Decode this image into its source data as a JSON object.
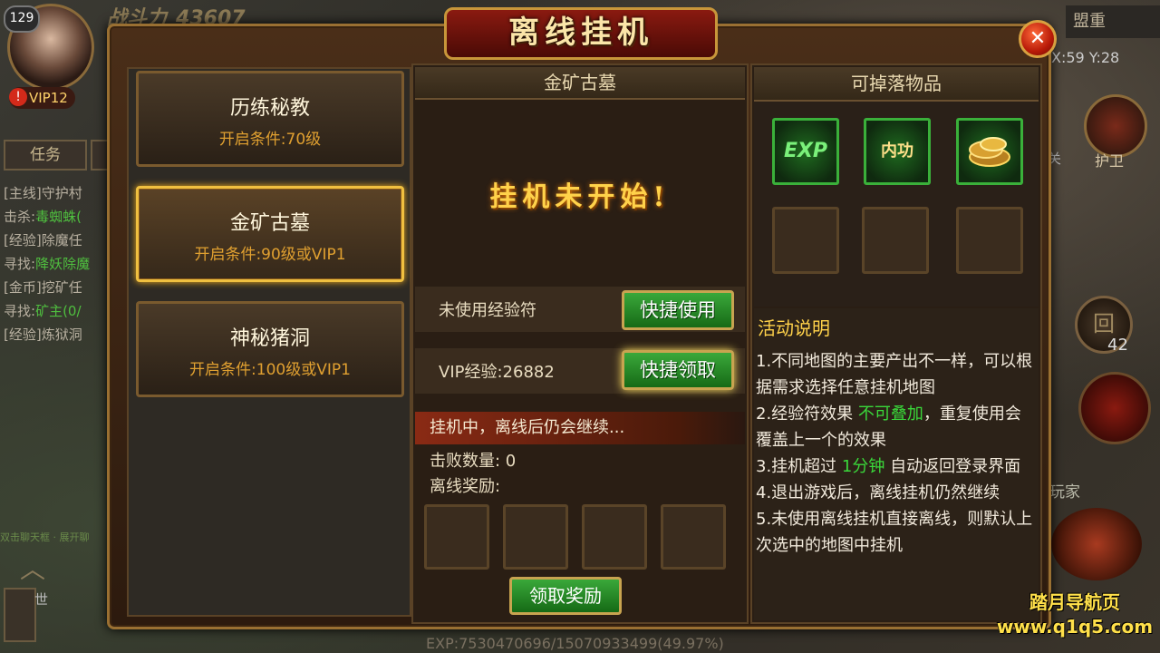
{
  "hud": {
    "level": "129",
    "vip": "VIP12",
    "power_label": "战斗力",
    "power_value": "43607",
    "task_tab": "任务",
    "quests": [
      {
        "tag": "[主线]",
        "text": "守护村"
      },
      {
        "tag": "击杀:",
        "text": "毒蜘蛛(",
        "hl": true
      },
      {
        "tag": "[经验]",
        "text": "除魔任"
      },
      {
        "tag": "寻找:",
        "text": "降妖除魔",
        "hl": true
      },
      {
        "tag": "[金币]",
        "text": "挖矿任"
      },
      {
        "tag": "寻找:",
        "text": "矿主(0/",
        "hl": true
      },
      {
        "tag": "[经验]",
        "text": "炼狱洞"
      }
    ],
    "chat_text": "双击聊天框 · 展开聊",
    "world_label": "世",
    "alliance": "盟重",
    "coords": "X:59 Y:28",
    "guard_label": "护卫",
    "guard_side_label": "关",
    "return_label": "回",
    "count_42": "42",
    "player_label": "玩家",
    "exp": "EXP:7530470696/15070933499(49.97%)"
  },
  "window": {
    "title": "离线挂机",
    "close_icon": "close-x-icon"
  },
  "maps": [
    {
      "name": "历练秘教",
      "cond": "开启条件:70级",
      "selected": false
    },
    {
      "name": "金矿古墓",
      "cond": "开启条件:90级或VIP1",
      "selected": true
    },
    {
      "name": "神秘猪洞",
      "cond": "开启条件:100级或VIP1",
      "selected": false
    }
  ],
  "middle": {
    "header": "金矿古墓",
    "not_started": "挂机未开始!",
    "exp_charm_label": "未使用经验符",
    "use_button": "快捷使用",
    "vip_exp_label": "VIP经验:26882",
    "claim_quick_button": "快捷领取",
    "status": "挂机中，离线后仍会继续...",
    "kills": "击败数量: 0",
    "reward_label": "离线奖励:",
    "claim_button": "领取奖励"
  },
  "right": {
    "drops_header": "可掉落物品",
    "items": [
      {
        "label": "EXP",
        "icon": "exp-icon"
      },
      {
        "label": "内功",
        "icon": "inner-power-icon"
      },
      {
        "label": "",
        "icon": "gold-coins-icon"
      }
    ],
    "desc_title": "活动说明",
    "desc": [
      {
        "parts": [
          "1.不同地图的主要产出不一样，可以根据需求选择任意挂机地图"
        ]
      },
      {
        "parts": [
          "2.经验符效果 ",
          "不可叠加",
          "，重复使用会覆盖上一个的效果"
        ]
      },
      {
        "parts": [
          "3.挂机超过 ",
          "1分钟",
          " 自动返回登录界面"
        ]
      },
      {
        "parts": [
          "4.退出游戏后，离线挂机仍然继续"
        ]
      },
      {
        "parts": [
          "5.未使用离线挂机直接离线，则默认上次选中的地图中挂机"
        ]
      }
    ]
  },
  "watermark": {
    "name": "踏月导航页",
    "url": "www.q1q5.com"
  },
  "colors": {
    "accent_gold": "#f0c040",
    "button_green": "#3aa83a",
    "highlight_green": "#3ad83a",
    "title_red": "#8a1a10"
  }
}
